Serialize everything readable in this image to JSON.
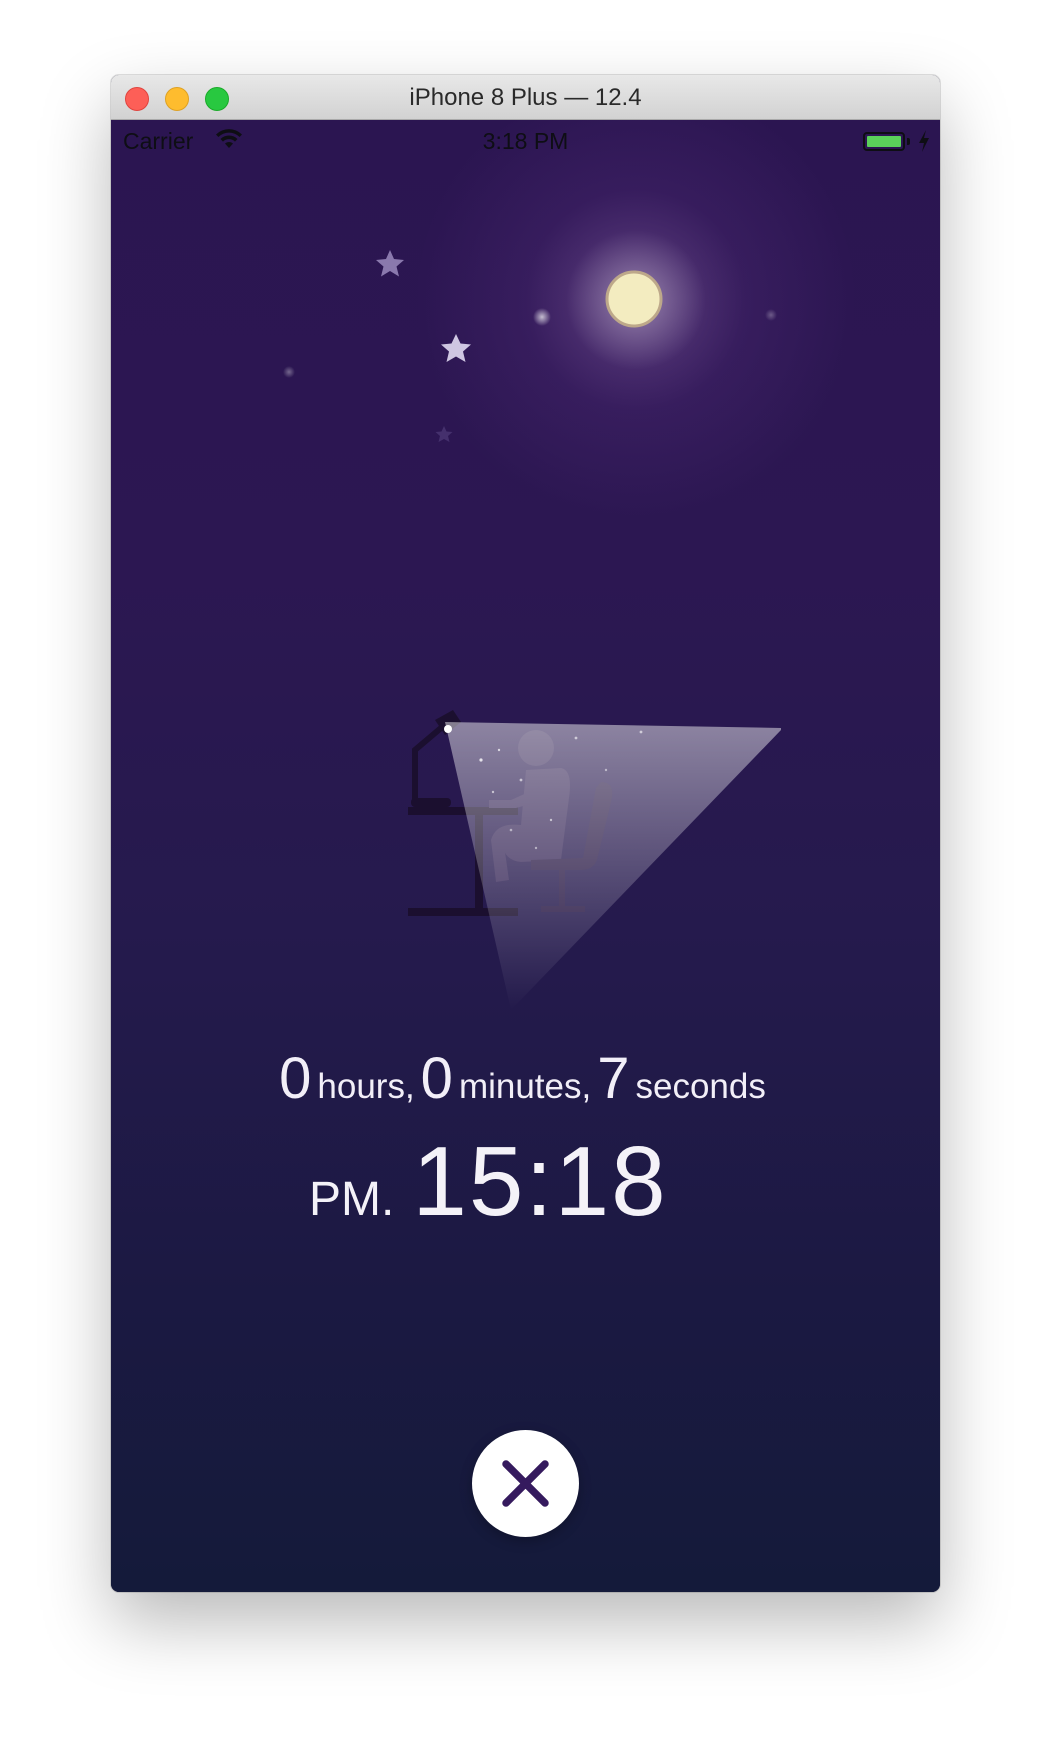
{
  "window": {
    "title": "iPhone 8 Plus — 12.4"
  },
  "status_bar": {
    "carrier": "Carrier",
    "time": "3:18 PM",
    "battery_color": "#5ad15a",
    "wifi_icon": "wifi-icon",
    "charging_icon": "bolt-icon"
  },
  "elapsed": {
    "hours": "0",
    "hours_label": "hours,",
    "minutes": "0",
    "minutes_label": "minutes,",
    "seconds": "7",
    "seconds_label": "seconds"
  },
  "clock": {
    "ampm": "PM.",
    "time": "15:18"
  },
  "dismiss": {
    "icon": "close-icon",
    "accent": "#351a5e"
  },
  "theme": {
    "background_top": "#2b1551",
    "background_bottom": "#141a3a",
    "text": "#f2eff8",
    "moon": "#f3ecc0"
  }
}
